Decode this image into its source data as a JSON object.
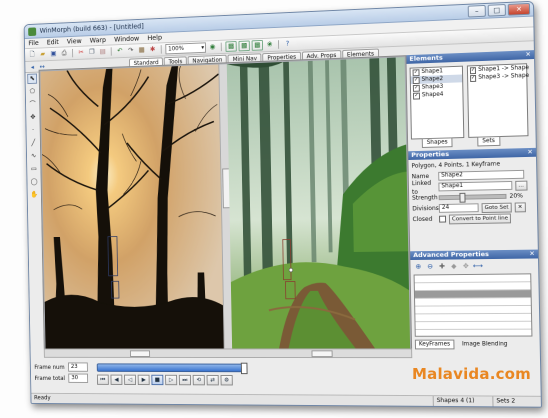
{
  "window": {
    "title": "WinMorph (build 663) - [Untitled]"
  },
  "window_buttons": {
    "minimize": "–",
    "maximize": "□",
    "close": "✕"
  },
  "menu": [
    "File",
    "Edit",
    "View",
    "Warp",
    "Window",
    "Help"
  ],
  "toolbar": {
    "zoom_value": "100%"
  },
  "tabs": [
    "Standard",
    "Tools",
    "Navigation",
    "Mini Nav",
    "Properties",
    "Adv. Props",
    "Elements"
  ],
  "frame": {
    "num_label": "Frame num",
    "num_value": "23",
    "total_label": "Frame total",
    "total_value": "30"
  },
  "elements": {
    "title": "Elements",
    "shapes": [
      "Shape1",
      "Shape2",
      "Shape3",
      "Shape4"
    ],
    "sets": [
      "Shape1 -> Shape",
      "Shape3 -> Shape"
    ],
    "shapes_tab": "Shapes",
    "sets_tab": "Sets"
  },
  "properties": {
    "title": "Properties",
    "summary": "Polygon, 4 Points, 1 Keyframe",
    "name_label": "Name",
    "name_value": "Shape2",
    "linked_label": "Linked to",
    "linked_value": "Shape1",
    "strength_label": "Strength",
    "strength_value": "20%",
    "strength_fraction": 0.3,
    "divisions_label": "Divisions",
    "divisions_value": "24",
    "goto_set": "Goto Set",
    "closed_label": "Closed",
    "convert": "Convert to Point line"
  },
  "advanced": {
    "title": "Advanced Properties",
    "tabs": [
      "KeyFrames",
      "Image Blending"
    ]
  },
  "status": {
    "ready": "Ready",
    "shapes": "Shapes 4 (1)",
    "sets": "Sets 2"
  },
  "watermark": "Malavida.com",
  "colors": {
    "title_bar": "#c9d9ee",
    "panel_header": "#4f74b2",
    "slider": "#3a74cf",
    "watermark": "#e98722"
  }
}
